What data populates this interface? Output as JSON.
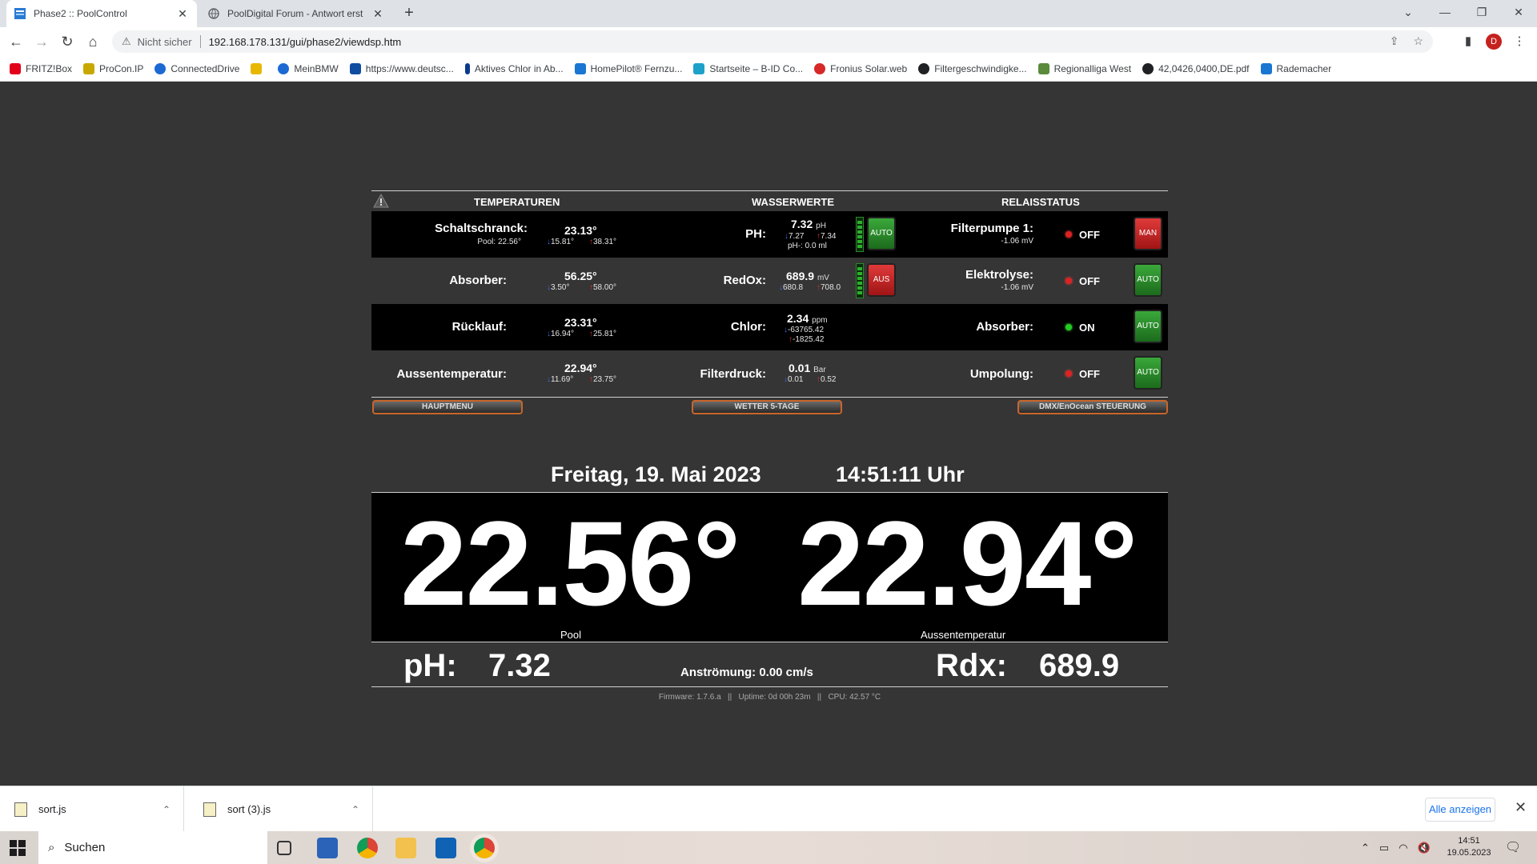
{
  "browser": {
    "tabs": [
      {
        "title": "Phase2 :: PoolControl",
        "active": true
      },
      {
        "title": "PoolDigital Forum - Antwort erst",
        "active": false
      }
    ],
    "security_label": "Nicht sicher",
    "url": "192.168.178.131/gui/phase2/viewdsp.htm",
    "profile_initial": "D",
    "bookmarks": [
      "FRITZ!Box",
      "ProCon.IP",
      "ConnectedDrive",
      "",
      "MeinBMW",
      "https://www.deutsc...",
      "Aktives Chlor in Ab...",
      "HomePilot® Fernzu...",
      "Startseite – B-ID Co...",
      "Fronius Solar.web",
      "Filtergeschwindigke...",
      "Regionalliga West",
      "42,0426,0400,DE.pdf",
      "Rademacher"
    ]
  },
  "headers": {
    "temperaturen": "TEMPERATUREN",
    "wasserwerte": "WASSERWERTE",
    "relaisstatus": "RELAISSTATUS"
  },
  "rows": [
    {
      "temp_label": "Schaltschranck:",
      "temp_sub": "Pool:  22.56°",
      "temp_value": "23.13°",
      "temp_min": "15.81°",
      "temp_max": "38.31°",
      "water_label": "PH:",
      "water_value": "7.32",
      "water_unit": "pH",
      "water_min": "7.27",
      "water_max": "7.34",
      "water_extra": "pH-: 0.0 ml",
      "water_mode": "AUTO",
      "relay_label": "Filterpumpe 1:",
      "relay_sub": "-1.06 mV",
      "relay_state": "OFF",
      "relay_mode": "MAN"
    },
    {
      "temp_label": "Absorber:",
      "temp_value": "56.25°",
      "temp_min": "3.50°",
      "temp_max": "58.00°",
      "water_label": "RedOx:",
      "water_value": "689.9",
      "water_unit": "mV",
      "water_min": "680.8",
      "water_max": "708.0",
      "water_mode": "AUS",
      "relay_label": "Elektrolyse:",
      "relay_sub": "-1.06 mV",
      "relay_state": "OFF",
      "relay_mode": "AUTO"
    },
    {
      "temp_label": "Rücklauf:",
      "temp_value": "23.31°",
      "temp_min": "16.94°",
      "temp_max": "25.81°",
      "water_label": "Chlor:",
      "water_value": "2.34",
      "water_unit": "ppm",
      "water_min": "-63765.42",
      "water_max": "-1825.42",
      "relay_label": "Absorber:",
      "relay_state": "ON",
      "relay_mode": "AUTO"
    },
    {
      "temp_label": "Aussentemperatur:",
      "temp_value": "22.94°",
      "temp_min": "11.69°",
      "temp_max": "23.75°",
      "water_label": "Filterdruck:",
      "water_value": "0.01",
      "water_unit": "Bar",
      "water_min": "0.01",
      "water_max": "0.52",
      "relay_label": "Umpolung:",
      "relay_state": "OFF",
      "relay_mode": "AUTO"
    }
  ],
  "nav": {
    "hauptmenu": "HAUPTMENU",
    "wetter": "WETTER 5-TAGE",
    "dmx": "DMX/EnOcean STEUERUNG"
  },
  "date": "Freitag, 19. Mai 2023",
  "time": "14:51:11 Uhr",
  "big": {
    "pool_value": "22.56°",
    "pool_label": "Pool",
    "aussen_value": "22.94°",
    "aussen_label": "Aussentemperatur"
  },
  "status": {
    "ph_label": "pH:",
    "ph_value": "7.32",
    "anstroemung": "Anströmung: 0.00 cm/s",
    "rdx_label": "Rdx:",
    "rdx_value": "689.9"
  },
  "footer": "Firmware: 1.7.6.a   ||   Uptime: 0d 00h 23m   ||   CPU: 42.57 °C",
  "downloads": {
    "items": [
      "sort.js",
      "sort (3).js"
    ],
    "show_all": "Alle anzeigen"
  },
  "taskbar": {
    "search_placeholder": "Suchen",
    "clock_time": "14:51",
    "clock_date": "19.05.2023"
  },
  "colors": {
    "panel_dark": "#000000",
    "panel_mid": "#353535",
    "auto_green": "#2e8b2e",
    "man_red": "#c02020",
    "nav_border": "#c8662a"
  }
}
